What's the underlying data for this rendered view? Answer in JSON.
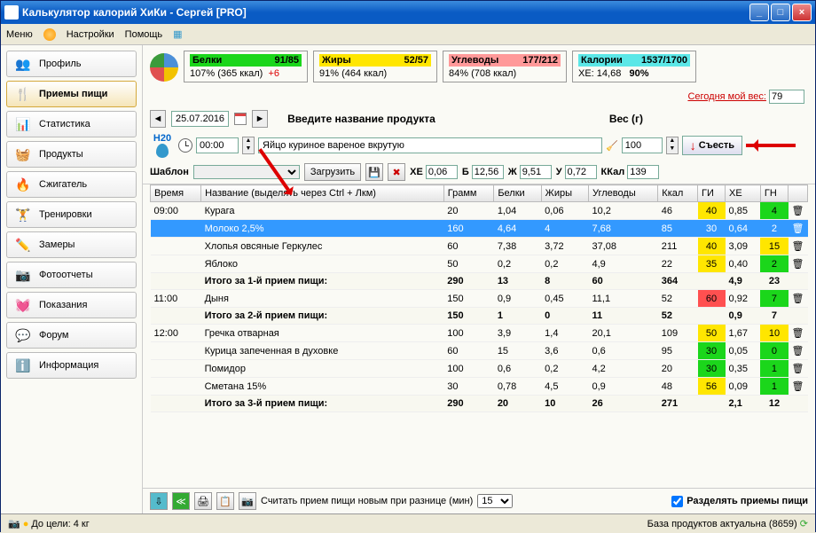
{
  "title": "Калькулятор калорий ХиКи - Сергей [PRO]",
  "menu": {
    "menu": "Меню",
    "settings": "Настройки",
    "help": "Помощь"
  },
  "sidebar": {
    "profile": "Профиль",
    "meals": "Приемы пищи",
    "stats": "Статистика",
    "products": "Продукты",
    "burner": "Сжигатель",
    "trainings": "Тренировки",
    "measures": "Замеры",
    "photos": "Фотоотчеты",
    "readings": "Показания",
    "forum": "Форум",
    "info": "Информация"
  },
  "nutrition": {
    "protein": {
      "label": "Белки",
      "val": "91/85",
      "pct": "107% (365 ккал)",
      "extra": "+6"
    },
    "fat": {
      "label": "Жиры",
      "val": "52/57",
      "pct": "91% (464 ккал)"
    },
    "carb": {
      "label": "Углеводы",
      "val": "177/212",
      "pct": "84% (708 ккал)"
    },
    "cal": {
      "label": "Калории",
      "val": "1537/1700",
      "xe": "ХЕ: 14,68",
      "pct": "90%"
    }
  },
  "weight": {
    "label": "Сегодня мой вес:",
    "val": "79"
  },
  "date": "25.07.2016",
  "productLabel": "Введите название продукта",
  "weightLabel": "Вес (г)",
  "time": "00:00",
  "product": "Яйцо куриное вареное вкрутую",
  "wval": "100",
  "eat": "Съесть",
  "tpl": {
    "label": "Шаблон",
    "load": "Загрузить"
  },
  "macros": {
    "xe": "0,06",
    "b": "12,56",
    "j": "9,51",
    "u": "0,72",
    "kcal": "139"
  },
  "headers": {
    "time": "Время",
    "name": "Название (выделять через Ctrl + Лкм)",
    "gram": "Грамм",
    "prot": "Белки",
    "fat": "Жиры",
    "carb": "Углеводы",
    "kcal": "Ккал",
    "gi": "ГИ",
    "xe": "ХЕ",
    "gn": "ГН"
  },
  "rows": [
    {
      "time": "09:00",
      "name": "Курага",
      "g": "20",
      "b": "1,04",
      "j": "0,06",
      "u": "10,2",
      "k": "46",
      "gi": "40",
      "gic": "y",
      "xe": "0,85",
      "gn": "4",
      "gnc": "g"
    },
    {
      "time": "",
      "name": "Молоко 2,5%",
      "g": "160",
      "b": "4,64",
      "j": "4",
      "u": "7,68",
      "k": "85",
      "gi": "30",
      "gic": "g",
      "xe": "0,64",
      "gn": "2",
      "gnc": "g",
      "sel": true
    },
    {
      "time": "",
      "name": "Хлопья овсяные Геркулес",
      "g": "60",
      "b": "7,38",
      "j": "3,72",
      "u": "37,08",
      "k": "211",
      "gi": "40",
      "gic": "y",
      "xe": "3,09",
      "gn": "15",
      "gnc": "y"
    },
    {
      "time": "",
      "name": "Яблоко",
      "g": "50",
      "b": "0,2",
      "j": "0,2",
      "u": "4,9",
      "k": "22",
      "gi": "35",
      "gic": "y",
      "xe": "0,40",
      "gn": "2",
      "gnc": "g"
    },
    {
      "subtotal": true,
      "name": "Итого за 1-й прием пищи:",
      "g": "290",
      "b": "13",
      "j": "8",
      "u": "60",
      "k": "364",
      "xe": "4,9",
      "gn": "23",
      "gnc": "r"
    },
    {
      "time": "11:00",
      "name": "Дыня",
      "g": "150",
      "b": "0,9",
      "j": "0,45",
      "u": "11,1",
      "k": "52",
      "gi": "60",
      "gic": "r",
      "xe": "0,92",
      "gn": "7",
      "gnc": "g"
    },
    {
      "subtotal": true,
      "name": "Итого за 2-й прием пищи:",
      "g": "150",
      "b": "1",
      "j": "0",
      "u": "11",
      "k": "52",
      "xe": "0,9",
      "gn": "7",
      "gnc": "g"
    },
    {
      "time": "12:00",
      "name": "Гречка отварная",
      "g": "100",
      "b": "3,9",
      "j": "1,4",
      "u": "20,1",
      "k": "109",
      "gi": "50",
      "gic": "y",
      "xe": "1,67",
      "gn": "10",
      "gnc": "y"
    },
    {
      "time": "",
      "name": "Курица запеченная в духовке",
      "g": "60",
      "b": "15",
      "j": "3,6",
      "u": "0,6",
      "k": "95",
      "gi": "30",
      "gic": "g",
      "xe": "0,05",
      "gn": "0",
      "gnc": "g"
    },
    {
      "time": "",
      "name": "Помидор",
      "g": "100",
      "b": "0,6",
      "j": "0,2",
      "u": "4,2",
      "k": "20",
      "gi": "30",
      "gic": "g",
      "xe": "0,35",
      "gn": "1",
      "gnc": "g"
    },
    {
      "time": "",
      "name": "Сметана 15%",
      "g": "30",
      "b": "0,78",
      "j": "4,5",
      "u": "0,9",
      "k": "48",
      "gi": "56",
      "gic": "y",
      "xe": "0,09",
      "gn": "1",
      "gnc": "g"
    },
    {
      "subtotal": true,
      "name": "Итого за 3-й прием пищи:",
      "g": "290",
      "b": "20",
      "j": "10",
      "u": "26",
      "k": "271",
      "xe": "2,1",
      "gn": "12",
      "gnc": "y"
    }
  ],
  "bottom": {
    "diff": "Считать прием пищи новым при разнице (мин)",
    "diffval": "15",
    "split": "Разделять приемы пищи"
  },
  "status": {
    "goal": "До цели: 4 кг",
    "db": "База продуктов актуальна (8659)"
  },
  "labels": {
    "xe": "ХЕ",
    "b": "Б",
    "j": "Ж",
    "u": "У",
    "kcal": "ККал",
    "h20": "H20"
  }
}
